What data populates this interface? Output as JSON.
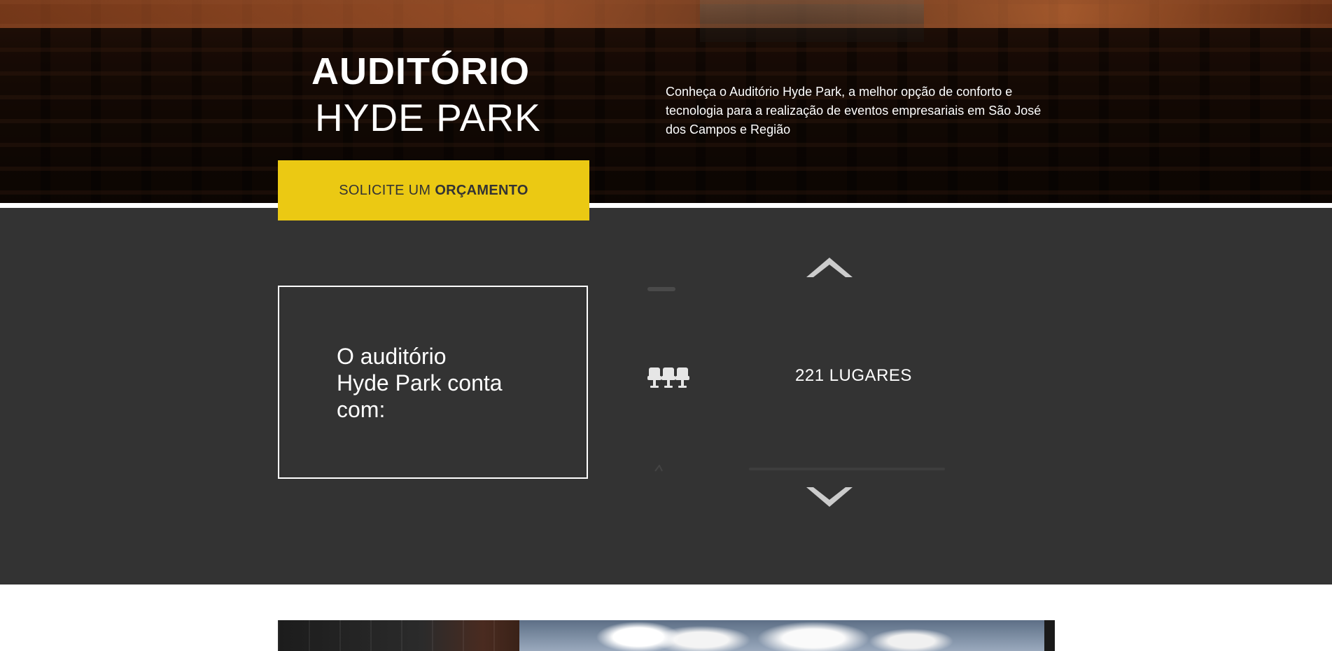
{
  "hero": {
    "title_line1": "AUDITÓRIO",
    "title_line2": "HYDE PARK",
    "intro": "Conheça o Auditório Hyde Park, a melhor opção de conforto e tecnologia para a realização de eventos empresariais em São José dos Campos e Região"
  },
  "cta": {
    "label_regular": "SOLICITE UM",
    "label_bold": "ORÇAMENTO"
  },
  "features": {
    "heading": "O auditório Hyde Park conta com:",
    "current_item": {
      "icon": "seats-icon",
      "label": "221 LUGARES"
    }
  },
  "colors": {
    "accent": "#ebc913",
    "dark_section": "#333333",
    "text_light": "#ffffff",
    "arrow": "#cccccc"
  }
}
